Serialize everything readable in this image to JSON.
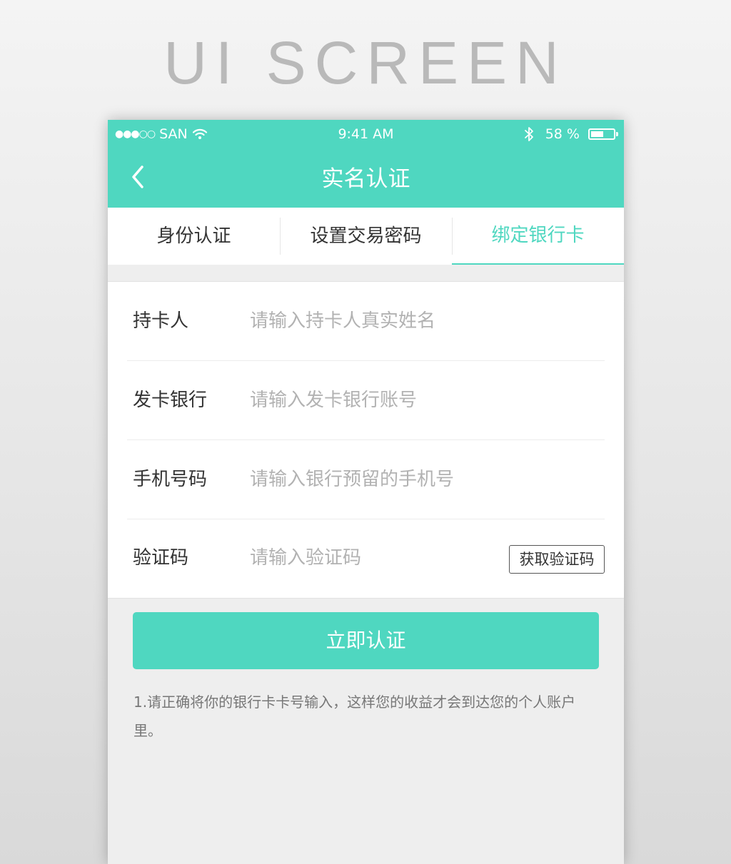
{
  "hero": {
    "title": "UI SCREEN"
  },
  "status_bar": {
    "signal_dots": "●●●○○",
    "carrier": "SAN",
    "time": "9:41 AM",
    "battery_text": "58 %",
    "battery_level": 0.58
  },
  "nav": {
    "title": "实名认证"
  },
  "tabs": [
    {
      "label": "身份认证",
      "active": false
    },
    {
      "label": "设置交易密码",
      "active": false
    },
    {
      "label": "绑定银行卡",
      "active": true
    }
  ],
  "form": {
    "rows": [
      {
        "label": "持卡人",
        "placeholder": "请输入持卡人真实姓名"
      },
      {
        "label": "发卡银行",
        "placeholder": "请输入发卡银行账号"
      },
      {
        "label": "手机号码",
        "placeholder": "请输入银行预留的手机号"
      },
      {
        "label": "验证码",
        "placeholder": "请输入验证码"
      }
    ],
    "get_code_label": "获取验证码"
  },
  "submit_label": "立即认证",
  "note": "1.请正确将你的银行卡卡号输入，这样您的收益才会到达您的个人账户里。",
  "colors": {
    "accent": "#4fd7c0",
    "text": "#333333",
    "placeholder": "#b2b2b2",
    "background": "#eeeeee"
  }
}
